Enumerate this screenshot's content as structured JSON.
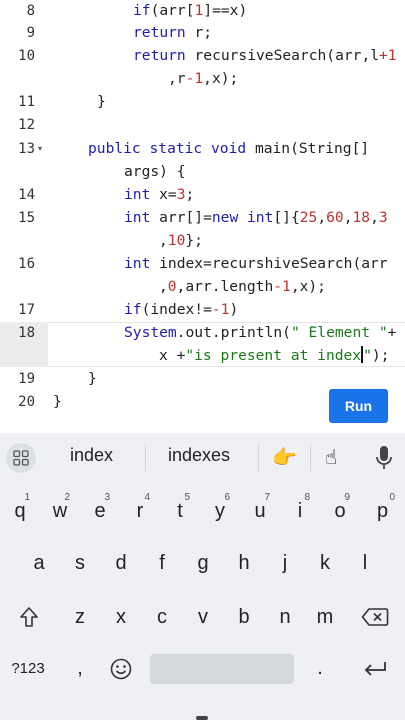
{
  "editor": {
    "line_numbers": [
      "8",
      "9",
      "10",
      "",
      "11",
      "12",
      "13",
      "",
      "14",
      "15",
      "",
      "16",
      "",
      "17",
      "18",
      "",
      "19",
      "20"
    ],
    "fold_marker": "▾",
    "run_label": "Run"
  },
  "keyboard": {
    "suggestions": [
      "index",
      "indexes"
    ],
    "emoji": [
      "👉",
      "☝"
    ],
    "row1": [
      "q",
      "w",
      "e",
      "r",
      "t",
      "y",
      "u",
      "i",
      "o",
      "p"
    ],
    "row1_digits": [
      "1",
      "2",
      "3",
      "4",
      "5",
      "6",
      "7",
      "8",
      "9",
      "0"
    ],
    "row2": [
      "a",
      "s",
      "d",
      "f",
      "g",
      "h",
      "j",
      "k",
      "l"
    ],
    "row3": [
      "z",
      "x",
      "c",
      "v",
      "b",
      "n",
      "m"
    ],
    "symbols_label": "?123",
    "comma": ",",
    "period": "."
  }
}
